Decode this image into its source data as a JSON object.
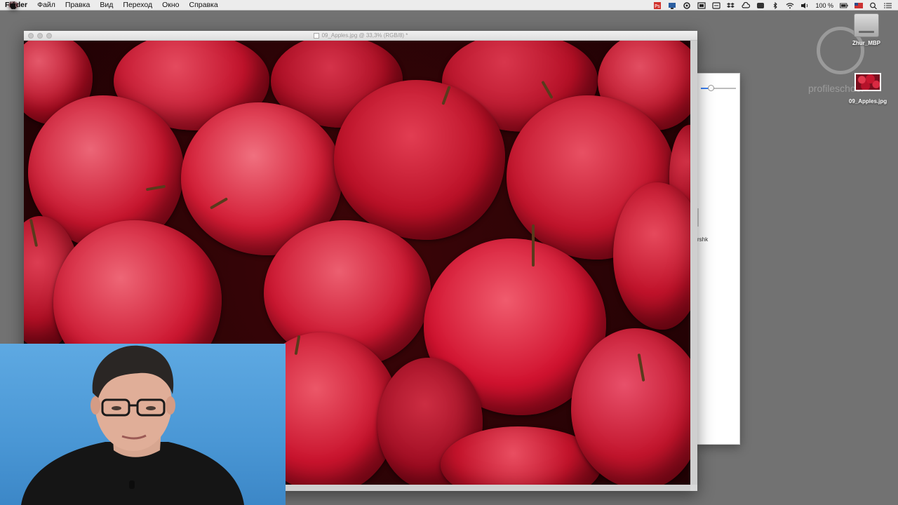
{
  "menubar": {
    "apple_icon": "apple-logo-icon",
    "items": [
      "Finder",
      "Файл",
      "Правка",
      "Вид",
      "Переход",
      "Окно",
      "Справка"
    ],
    "battery_text": "100 %"
  },
  "desktop": {
    "drive_label": "Zhur_MBP",
    "file_label": "09_Apples.jpg",
    "watermark_text": "profileschool"
  },
  "document": {
    "title": "09_Apples.jpg @ 33,3% (RGB/8) *"
  },
  "bg_window": {
    "partial_text": "rshk"
  },
  "colors": {
    "desktop_bg": "#727272",
    "menubar_bg": "#ececec",
    "apple_red": "#c8142c",
    "webcam_blue": "#4a97d5"
  }
}
